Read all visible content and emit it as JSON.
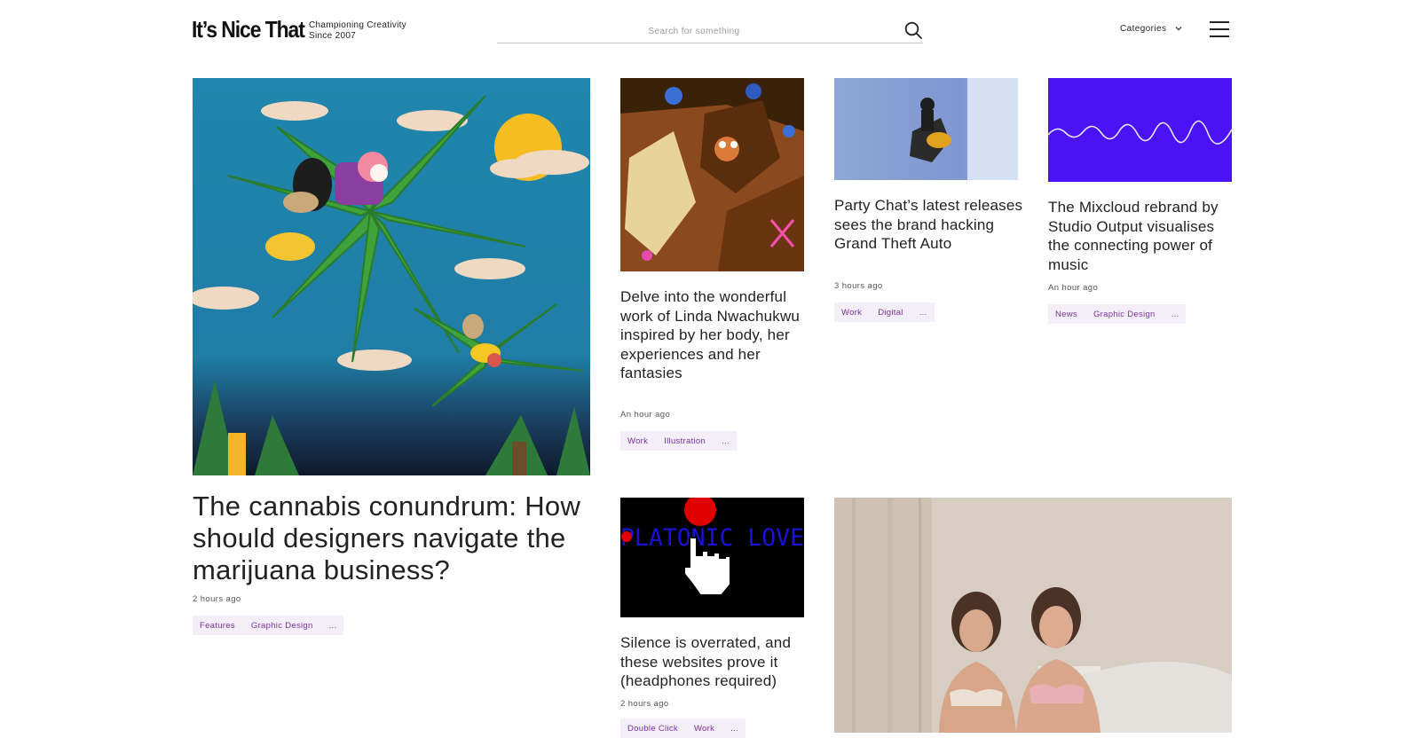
{
  "header": {
    "logo": "It’s Nice That",
    "tagline_line1": "Championing Creativity",
    "tagline_line2": "Since 2007",
    "search_placeholder": "Search for something",
    "categories_label": "Categories"
  },
  "articles": [
    {
      "title": "The cannabis conundrum: How should designers navigate the marijuana business?",
      "time": "2 hours ago",
      "tags": [
        "Features",
        "Graphic Design",
        "..."
      ]
    },
    {
      "title": "Delve into the wonderful work of Linda Nwachukwu inspired by her body, her experiences and her fantasies",
      "time": "An hour ago",
      "tags": [
        "Work",
        "Illustration",
        "..."
      ]
    },
    {
      "title": "Party Chat’s latest releases sees the brand hacking Grand Theft Auto",
      "time": "3 hours ago",
      "tags": [
        "Work",
        "Digital",
        "..."
      ]
    },
    {
      "title": "The Mixcloud rebrand by Studio Output visualises the connecting power of music",
      "time": "An hour ago",
      "tags": [
        "News",
        "Graphic Design",
        "..."
      ]
    },
    {
      "title": "Silence is overrated, and these websites prove it (headphones required)",
      "time": "2 hours ago",
      "tags": [
        "Double Click",
        "Work",
        "..."
      ],
      "image_text": "PLATONIC LOVE"
    }
  ],
  "colors": {
    "tag_background": "#f4eef8",
    "tag_text": "#7b2f9e",
    "mixcloud_purple": "#4b12f5",
    "cannabis_sky": "#1f86ad"
  },
  "icons": [
    "search-icon",
    "chevron-down-icon",
    "hamburger-menu-icon"
  ]
}
